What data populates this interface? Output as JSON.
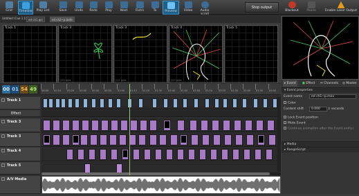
{
  "toolbar": {
    "buttons": [
      {
        "label": "Grid"
      },
      {
        "label": "Timeline"
      },
      {
        "label": "Play List"
      },
      {
        "label": "Save"
      },
      {
        "label": "Undo"
      },
      {
        "label": "Redo"
      },
      {
        "label": "Play"
      },
      {
        "label": "Next"
      },
      {
        "label": "Fixtrs"
      },
      {
        "label": "To"
      },
      {
        "label": "Preview"
      },
      {
        "label": "Video"
      },
      {
        "label": "Audio scroll"
      }
    ],
    "stop_output": "Stop output",
    "blackout": "Blackout",
    "pause": "Pause",
    "enable_laser": "Enable Laser Output"
  },
  "tabs": {
    "show": "Untitled (Cue 1.1)",
    "file1": "ed ch1.qcr",
    "file2": "ed ch2~p.bafe"
  },
  "previews": [
    {
      "label": "Track 1",
      "footer": ""
    },
    {
      "label": "Track 3",
      "footer": "200 pnts"
    },
    {
      "label": "Track 3",
      "footer": "217 pnts"
    },
    {
      "label": "Track 4",
      "footer": "253 pnts"
    },
    {
      "label": "Track 5",
      "footer": ""
    }
  ],
  "timecode": {
    "h": "00",
    "m": "01",
    "s": "54",
    "f": "49"
  },
  "ruler_labels": [
    "00:00",
    "00:10",
    "00:20",
    "00:30",
    "00:40",
    "00:50",
    "01:00",
    "01:10",
    "01:20",
    "01:30",
    "01:40",
    "01:50",
    "02:00",
    "02:10",
    "02:20",
    "02:30",
    "02:40",
    "02:50",
    "03:00"
  ],
  "tracks": [
    {
      "name": "Track 1"
    },
    {
      "name": "Effect"
    },
    {
      "name": "Track 3"
    },
    {
      "name": "Track 3"
    },
    {
      "name": "Track 4"
    },
    {
      "name": "Track 5"
    },
    {
      "name": "A/V Media"
    }
  ],
  "panel": {
    "tabs": [
      "Event",
      "Effect",
      "Channels",
      "Master"
    ],
    "section_event": "Event properties",
    "event_name_label": "Event name",
    "event_name_value": "ed ch1~p.mov",
    "color_label": "Color",
    "content_shift_label": "Content shift",
    "content_shift_value": "0.000",
    "seconds": "seconds",
    "lock_event": "Lock Event position",
    "mute_event": "Mute Event",
    "continue_anim": "Continue animation after the Event end(s)",
    "media": "Media",
    "rangescript": "RangeScript"
  },
  "colors": {
    "accent": "#1e5f8a",
    "clip_blue": "#8fb4d8",
    "clip_purple": "#a87bc8",
    "playhead": "#9fc27a"
  }
}
